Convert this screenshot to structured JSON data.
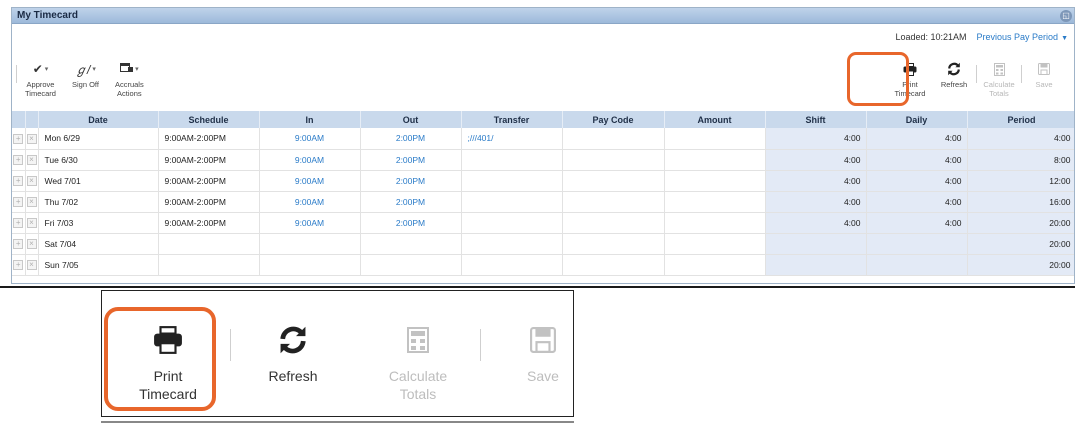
{
  "window": {
    "title": "My Timecard",
    "ctrl_icon": "restore-icon"
  },
  "status": {
    "loaded": "Loaded: 10:21AM",
    "pay_period": "Previous Pay Period"
  },
  "toolbar_left": [
    {
      "icon": "checkmark-icon",
      "label": "Approve\nTimecard"
    },
    {
      "icon": "signoff-icon",
      "label": "Sign Off"
    },
    {
      "icon": "accruals-icon",
      "label": "Accruals\nActions"
    }
  ],
  "toolbar_right": [
    {
      "icon": "printer-icon",
      "label": "Print\nTimecard",
      "enabled": true
    },
    {
      "icon": "refresh-icon",
      "label": "Refresh",
      "enabled": true
    },
    {
      "icon": "calculator-icon",
      "label": "Calculate\nTotals",
      "enabled": false
    },
    {
      "icon": "save-icon",
      "label": "Save",
      "enabled": false
    }
  ],
  "table": {
    "headers": [
      "Date",
      "Schedule",
      "In",
      "Out",
      "Transfer",
      "Pay Code",
      "Amount",
      "Shift",
      "Daily",
      "Period"
    ],
    "rows": [
      {
        "date": "Mon 6/29",
        "schedule": "9:00AM-2:00PM",
        "in": "9:00AM",
        "out": "2:00PM",
        "transfer": ";///401/",
        "pay_code": "",
        "amount": "",
        "shift": "4:00",
        "daily": "4:00",
        "period": "4:00"
      },
      {
        "date": "Tue 6/30",
        "schedule": "9:00AM-2:00PM",
        "in": "9:00AM",
        "out": "2:00PM",
        "transfer": "",
        "pay_code": "",
        "amount": "",
        "shift": "4:00",
        "daily": "4:00",
        "period": "8:00"
      },
      {
        "date": "Wed 7/01",
        "schedule": "9:00AM-2:00PM",
        "in": "9:00AM",
        "out": "2:00PM",
        "transfer": "",
        "pay_code": "",
        "amount": "",
        "shift": "4:00",
        "daily": "4:00",
        "period": "12:00"
      },
      {
        "date": "Thu 7/02",
        "schedule": "9:00AM-2:00PM",
        "in": "9:00AM",
        "out": "2:00PM",
        "transfer": "",
        "pay_code": "",
        "amount": "",
        "shift": "4:00",
        "daily": "4:00",
        "period": "16:00"
      },
      {
        "date": "Fri 7/03",
        "schedule": "9:00AM-2:00PM",
        "in": "9:00AM",
        "out": "2:00PM",
        "transfer": "",
        "pay_code": "",
        "amount": "",
        "shift": "4:00",
        "daily": "4:00",
        "period": "20:00"
      },
      {
        "date": "Sat 7/04",
        "schedule": "",
        "in": "",
        "out": "",
        "transfer": "",
        "pay_code": "",
        "amount": "",
        "shift": "",
        "daily": "",
        "period": "20:00"
      },
      {
        "date": "Sun 7/05",
        "schedule": "",
        "in": "",
        "out": "",
        "transfer": "",
        "pay_code": "",
        "amount": "",
        "shift": "",
        "daily": "",
        "period": "20:00"
      }
    ]
  },
  "zoom": [
    {
      "icon": "printer-icon",
      "label": "Print\nTimecard",
      "enabled": true
    },
    {
      "icon": "refresh-icon",
      "label": "Refresh",
      "enabled": true
    },
    {
      "icon": "calculator-icon",
      "label": "Calculate\nTotals",
      "enabled": false
    },
    {
      "icon": "save-icon",
      "label": "Save",
      "enabled": false
    }
  ],
  "colors": {
    "highlight": "#e8662b",
    "link": "#2a7bc8",
    "header_bg": "#c9d9ec",
    "totals_bg": "#e3eaf6"
  }
}
